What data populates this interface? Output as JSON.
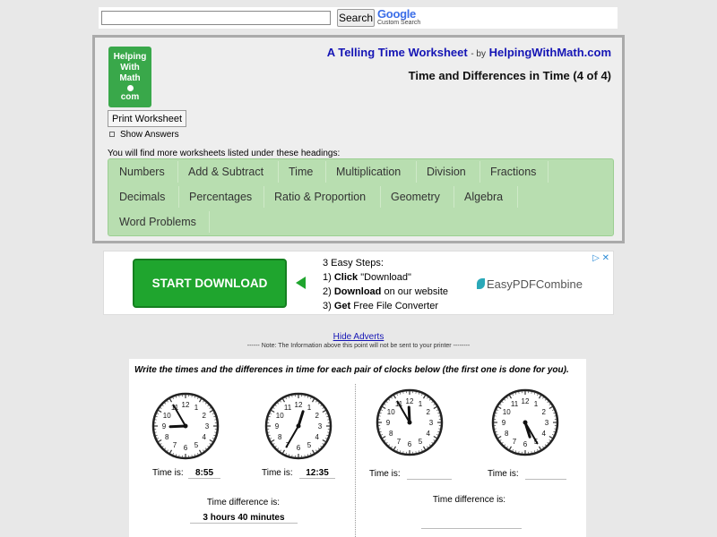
{
  "search": {
    "button_label": "Search",
    "logo_text": "Google",
    "logo_sub": "Custom Search"
  },
  "header": {
    "logo_lines": [
      "Helping",
      "With",
      "Math",
      "com"
    ],
    "title": "A Telling Time Worksheet",
    "by": "- by",
    "site": "HelpingWithMath.com",
    "subtitle": "Time and Differences in Time (4 of 4)",
    "print_label": "Print Worksheet",
    "show_answers_label": "Show Answers",
    "more_text": "You will find more worksheets listed under these headings:"
  },
  "categories": [
    [
      "Numbers",
      "Add & Subtract",
      "Time",
      "Multiplication",
      "Division",
      "Fractions"
    ],
    [
      "Decimals",
      "Percentages",
      "Ratio & Proportion",
      "Geometry",
      "Algebra"
    ],
    [
      "Word Problems"
    ]
  ],
  "ad": {
    "download_label": "START DOWNLOAD",
    "steps_title": "3 Easy Steps:",
    "step1_pre": "1) ",
    "step1_bold": "Click",
    "step1_post": " \"Download\"",
    "step2_pre": "2) ",
    "step2_bold": "Download",
    "step2_post": " on our website",
    "step3_pre": "3) ",
    "step3_bold": "Get",
    "step3_post": " Free File Converter",
    "brand": "EasyPDFCombine",
    "close_label": "▷ ✕"
  },
  "hide_adverts": "Hide Adverts",
  "print_note": "------ Note: The Information above this point will not be sent to your printer --------",
  "worksheet": {
    "instructions": "Write the times and the differences in time for each pair of clocks below (the first one is done for you).",
    "time_is_label": "Time is:",
    "diff_label": "Time difference is:",
    "pair1": {
      "time1": "8:55",
      "time2": "12:35",
      "difference": "3 hours 40 minutes"
    },
    "pair2": {
      "time1": "",
      "time2": "",
      "difference": ""
    }
  },
  "clocks": [
    {
      "hour": 8,
      "minute": 55
    },
    {
      "hour": 12,
      "minute": 35
    },
    {
      "hour": 11,
      "minute": 55
    },
    {
      "hour": 5,
      "minute": 25
    }
  ]
}
